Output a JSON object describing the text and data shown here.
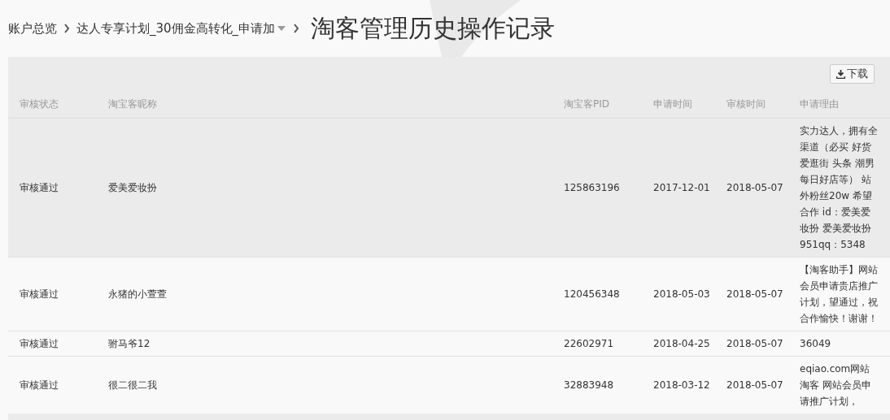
{
  "breadcrumb": {
    "items": [
      {
        "label": "账户总览"
      },
      {
        "label": "达人专享计划_30佣金高转化_申请加",
        "dropdown": true
      }
    ],
    "title": "淘客管理历史操作记录"
  },
  "toolbar": {
    "download_button": "下载"
  },
  "table": {
    "columns": [
      "审核状态",
      "淘宝客昵称",
      "淘宝客PID",
      "申请时间",
      "审核时间",
      "申请理由"
    ],
    "rows": [
      {
        "highlighted": true,
        "cells": [
          "审核通过",
          "爱美爱妆扮",
          "125863196",
          "2017-12-01",
          "2018-05-07",
          "实力达人，拥有全渠道（必买 好货爱逛街 头条 潮男每日好店等） 站外粉丝20w 希望合作 id：爱美爱妆扮 爱美爱妆扮951qq：5348"
        ]
      },
      {
        "highlighted": false,
        "cells": [
          "审核通过",
          "永猪的小萱萱",
          "120456348",
          "2018-05-03",
          "2018-05-07",
          "【淘客助手】网站会员申请贵店推广计划，望通过，祝合作愉快！谢谢！"
        ]
      },
      {
        "highlighted": false,
        "cells": [
          "审核通过",
          "驸马爷12",
          "22602971",
          "2018-04-25",
          "2018-05-07",
          "36049"
        ]
      },
      {
        "highlighted": false,
        "cells": [
          "审核通过",
          "很二很二我",
          "32883948",
          "2018-03-12",
          "2018-05-07",
          "eqiao.com网站淘客 网站会员申请推广计划，"
        ]
      }
    ]
  }
}
